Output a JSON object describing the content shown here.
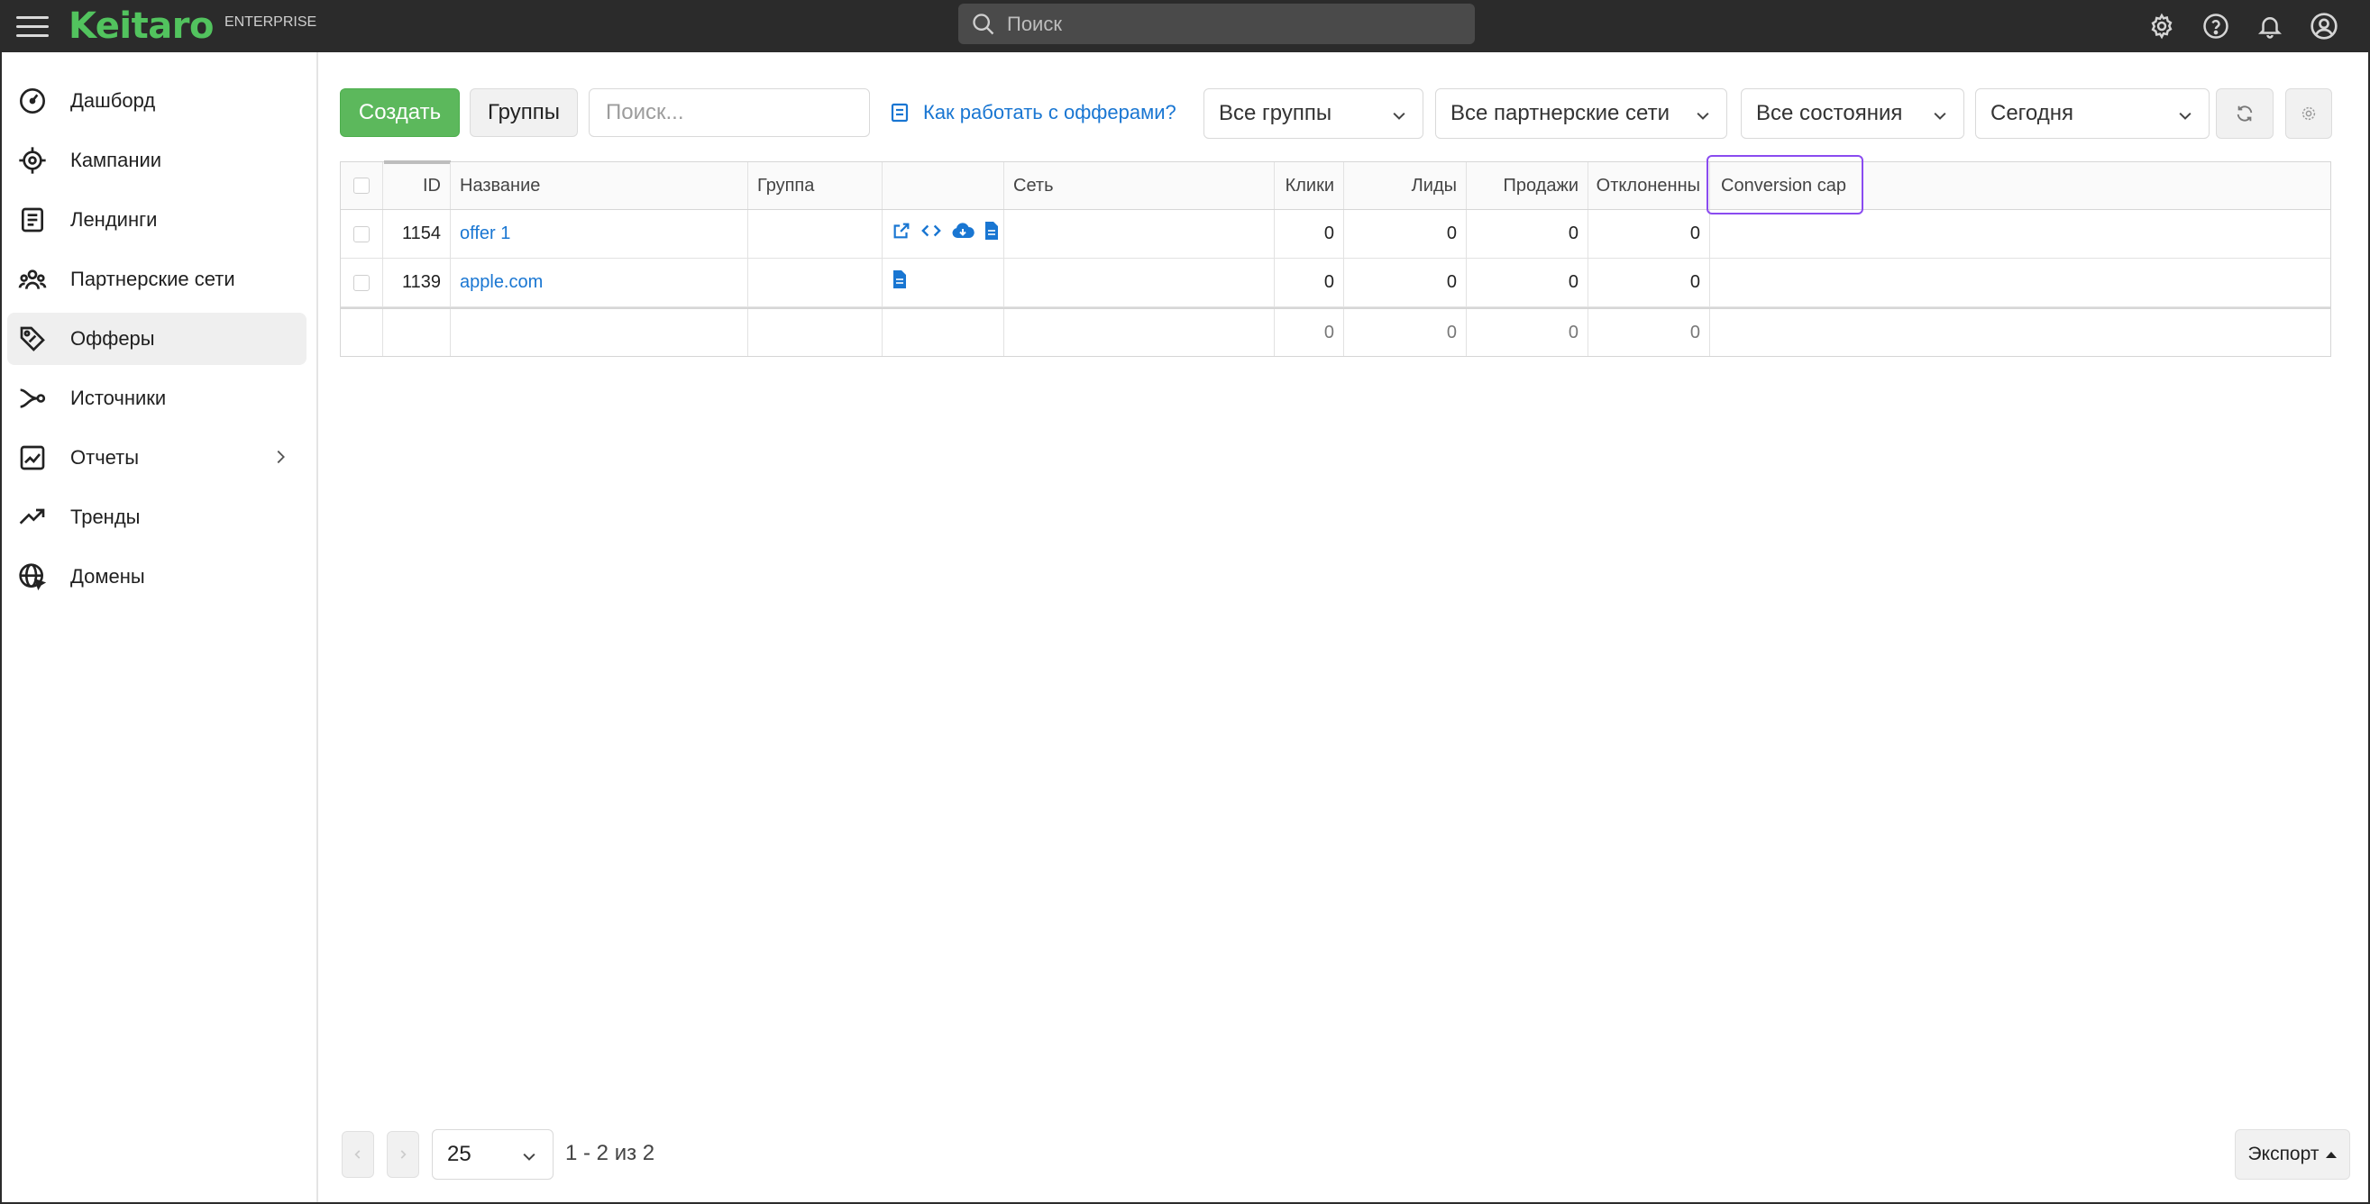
{
  "app": {
    "logo": "Keitaro",
    "edition": "ENTERPRISE",
    "search_placeholder": "Поиск"
  },
  "colors": {
    "topbar": "#2b2b2b",
    "brand_green": "#52c35e",
    "link_blue": "#1976d2",
    "create_green": "#5cb85c",
    "highlight_purple": "#8a4bf0"
  },
  "sidebar": {
    "items": [
      {
        "label": "Дашборд",
        "icon": "dashboard-icon"
      },
      {
        "label": "Кампании",
        "icon": "target-icon"
      },
      {
        "label": "Лендинги",
        "icon": "landing-icon"
      },
      {
        "label": "Партнерские сети",
        "icon": "network-icon"
      },
      {
        "label": "Офферы",
        "icon": "tag-icon"
      },
      {
        "label": "Источники",
        "icon": "source-icon"
      },
      {
        "label": "Отчеты",
        "icon": "report-icon"
      },
      {
        "label": "Тренды",
        "icon": "trend-icon"
      },
      {
        "label": "Домены",
        "icon": "domain-icon"
      }
    ],
    "active": "Офферы"
  },
  "toolbar": {
    "create_label": "Создать",
    "groups_label": "Группы",
    "search_placeholder": "Поиск...",
    "help_link": "Как работать с офферами?",
    "filter_groups": "Все группы",
    "filter_networks": "Все партнерские сети",
    "filter_states": "Все состояния",
    "filter_period": "Сегодня"
  },
  "table": {
    "headers": {
      "id": "ID",
      "name": "Название",
      "group": "Группа",
      "actions": "",
      "network": "Сеть",
      "clicks": "Клики",
      "leads": "Лиды",
      "sales": "Продажи",
      "rejected": "Отклоненны",
      "conversion_cap": "Conversion cap"
    },
    "rows": [
      {
        "id": "1154",
        "name": "offer 1",
        "group": "",
        "network": "",
        "clicks": "0",
        "leads": "0",
        "sales": "0",
        "rejected": "0",
        "conversion_cap": ""
      },
      {
        "id": "1139",
        "name": "apple.com",
        "group": "",
        "network": "",
        "clicks": "0",
        "leads": "0",
        "sales": "0",
        "rejected": "0",
        "conversion_cap": ""
      }
    ],
    "totals": {
      "clicks": "0",
      "leads": "0",
      "sales": "0",
      "rejected": "0"
    }
  },
  "pagination": {
    "page_size": "25",
    "info": "1 - 2 из 2",
    "export_label": "Экспорт"
  }
}
